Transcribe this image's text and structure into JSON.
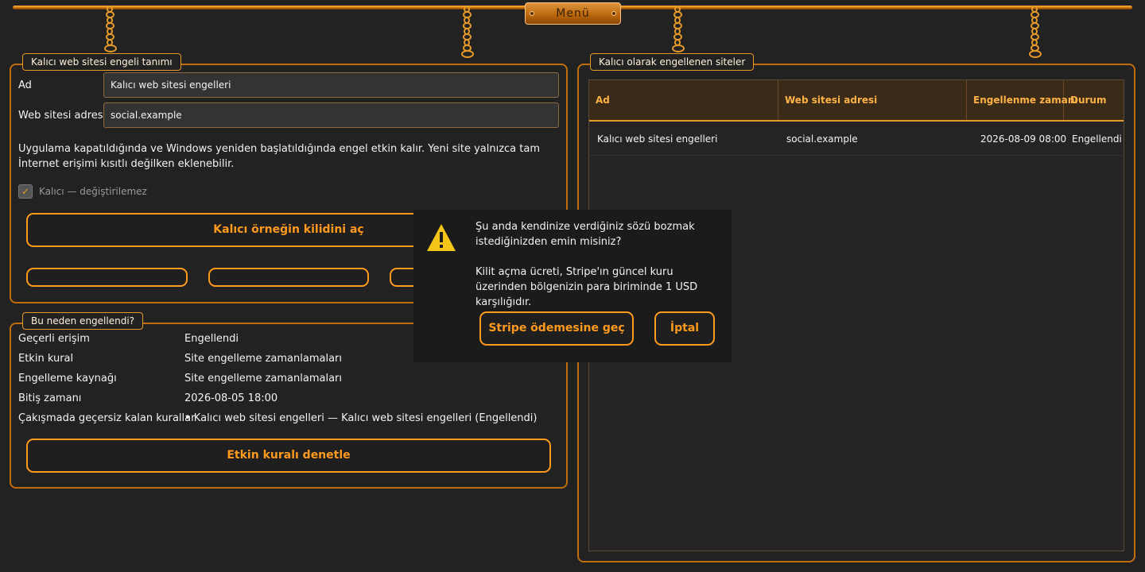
{
  "menu": {
    "label": "Menü"
  },
  "definition": {
    "title": "Kalıcı web sitesi engeli tanımı",
    "name_label": "Ad",
    "name_value": "Kalıcı web sitesi engelleri",
    "site_label": "Web sitesi adresi",
    "site_value": "social.example",
    "note": "Uygulama kapatıldığında ve Windows yeniden başlatıldığında engel etkin kalır. Yeni site yalnızca tam İnternet erişimi kısıtlı değilken eklenebilir.",
    "checkbox_label": "Kalıcı — değiştirilemez",
    "checkbox_checked": true,
    "unlock_button": "Kalıcı örneğin kilidini aç"
  },
  "blocked_sites": {
    "title": "Kalıcı olarak engellenen siteler",
    "columns": [
      "Ad",
      "Web sitesi adresi",
      "Engellenme zamanı",
      "Durum"
    ],
    "rows": [
      [
        "Kalıcı web sitesi engelleri",
        "social.example",
        "2026-08-09 08:00",
        "Engellendi"
      ]
    ]
  },
  "reason": {
    "title": "Bu neden engellendi?",
    "rows": [
      {
        "label": "Geçerli erişim",
        "value": "Engellendi"
      },
      {
        "label": "Etkin kural",
        "value": "Site engelleme zamanlamaları"
      },
      {
        "label": "Engelleme kaynağı",
        "value": "Site engelleme zamanlamaları"
      },
      {
        "label": "Bitiş zamanı",
        "value": "2026-08-05 18:00"
      },
      {
        "label": "Çakışmada geçersiz kalan kurallar",
        "value": "• Kalıcı web sitesi engelleri — Kalıcı web sitesi engelleri (Engellendi)"
      }
    ],
    "inspect_button": "Etkin kuralı denetle"
  },
  "dialog": {
    "question": "Şu anda kendinize verdiğiniz sözü bozmak istediğinizden emin misiniz?",
    "fee_note": "Kilit açma ücreti, Stripe'ın güncel kuru üzerinden bölgenizin para biriminde 1 USD karşılığıdır.",
    "confirm_button": "Stripe ödemesine geç",
    "cancel_button": "İptal"
  },
  "colors": {
    "accent": "#ff9a1e",
    "background": "#222222",
    "warning": "#f5c518"
  }
}
